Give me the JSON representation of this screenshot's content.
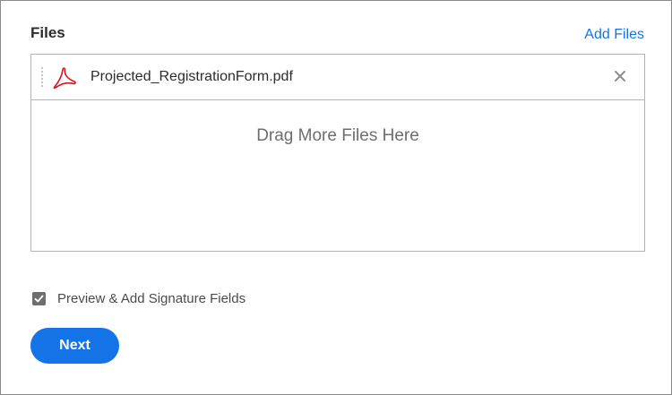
{
  "files_section": {
    "title": "Files",
    "add_files_label": "Add Files"
  },
  "file_list": {
    "items": [
      {
        "name": "Projected_RegistrationForm.pdf",
        "icon": "pdf-icon"
      }
    ],
    "remove_icon": "close-icon"
  },
  "drop_zone": {
    "text": "Drag More Files Here"
  },
  "options": {
    "preview_label": "Preview & Add Signature Fields",
    "preview_checked": true
  },
  "actions": {
    "next_label": "Next"
  },
  "colors": {
    "accent": "#1473e6",
    "pdf_red": "#d4131b",
    "text": "#2c2c2c",
    "muted": "#6e6e6e"
  }
}
